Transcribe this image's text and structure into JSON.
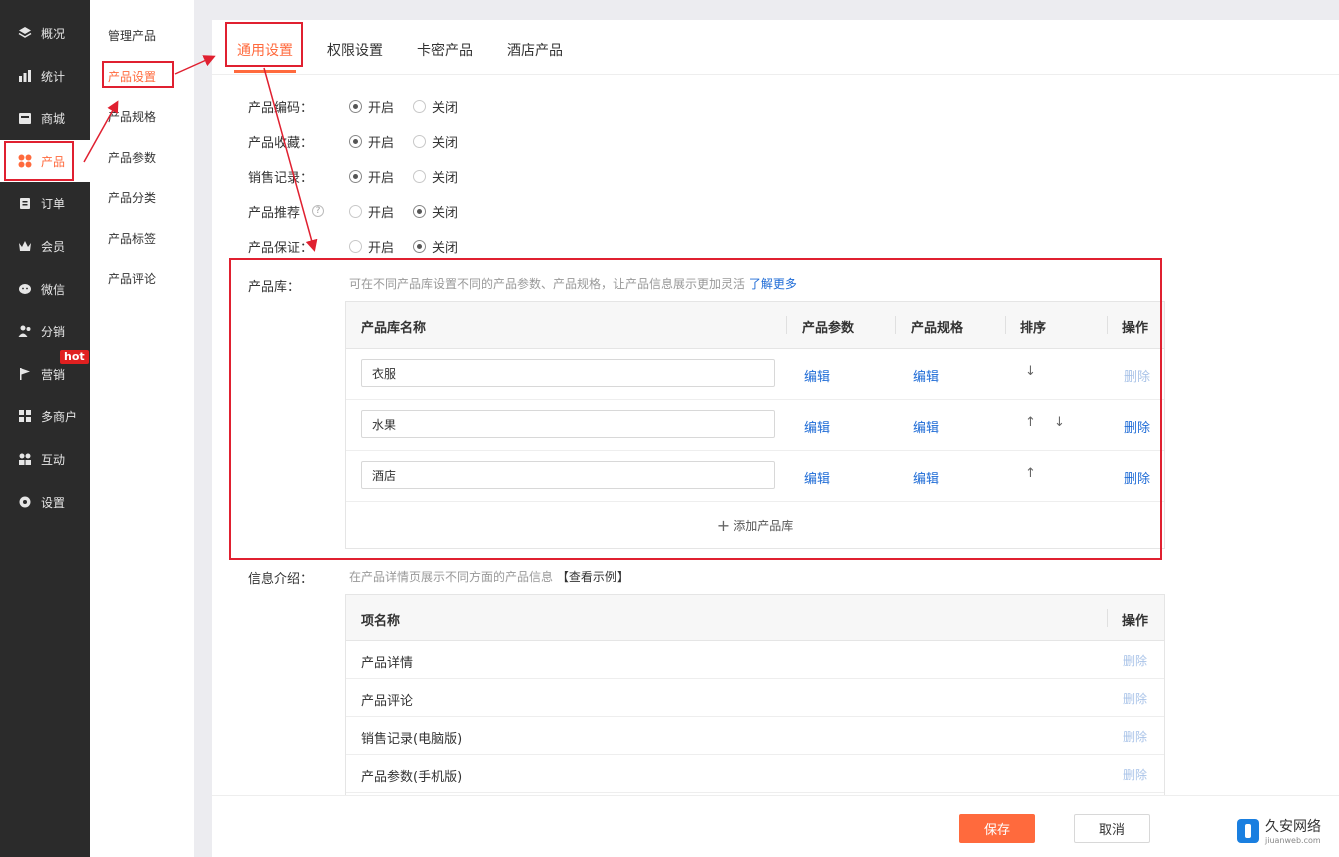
{
  "sidebar": {
    "items": [
      {
        "label": "概况",
        "icon": "layers-icon"
      },
      {
        "label": "统计",
        "icon": "chart-icon"
      },
      {
        "label": "商城",
        "icon": "shop-icon"
      },
      {
        "label": "产品",
        "icon": "grid-icon"
      },
      {
        "label": "订单",
        "icon": "clipboard-icon"
      },
      {
        "label": "会员",
        "icon": "crown-icon"
      },
      {
        "label": "微信",
        "icon": "wechat-icon"
      },
      {
        "label": "分销",
        "icon": "users-icon"
      },
      {
        "label": "营销",
        "icon": "flag-icon"
      },
      {
        "label": "多商户",
        "icon": "store-icon"
      },
      {
        "label": "互动",
        "icon": "people-icon"
      },
      {
        "label": "设置",
        "icon": "gear-icon"
      }
    ],
    "hot_badge": "hot"
  },
  "subnav": {
    "items": [
      "管理产品",
      "产品设置",
      "产品规格",
      "产品参数",
      "产品分类",
      "产品标签",
      "产品评论"
    ]
  },
  "tabs": [
    "通用设置",
    "权限设置",
    "卡密产品",
    "酒店产品"
  ],
  "settings": [
    {
      "label": "产品编码：",
      "on": "开启",
      "off": "关闭",
      "value": "on"
    },
    {
      "label": "产品收藏：",
      "on": "开启",
      "off": "关闭",
      "value": "on"
    },
    {
      "label": "销售记录：",
      "on": "开启",
      "off": "关闭",
      "value": "on"
    },
    {
      "label": "产品推荐",
      "on": "开启",
      "off": "关闭",
      "value": "off"
    },
    {
      "label": "产品保证：",
      "on": "开启",
      "off": "关闭",
      "value": "off"
    }
  ],
  "library": {
    "label": "产品库：",
    "hint": "可在不同产品库设置不同的产品参数、产品规格，让产品信息展示更加灵活",
    "hint_link": "了解更多",
    "columns": [
      "产品库名称",
      "产品参数",
      "产品规格",
      "排序",
      "操作"
    ],
    "rows": [
      {
        "name": "衣服",
        "param": "编辑",
        "spec": "编辑",
        "up": "",
        "down": "↓",
        "action": "删除",
        "action_enabled": false
      },
      {
        "name": "水果",
        "param": "编辑",
        "spec": "编辑",
        "up": "↑",
        "down": "↓",
        "action": "删除",
        "action_enabled": true
      },
      {
        "name": "酒店",
        "param": "编辑",
        "spec": "编辑",
        "up": "↑",
        "down": "",
        "action": "删除",
        "action_enabled": true
      }
    ],
    "add_label": "添加产品库"
  },
  "info": {
    "label": "信息介绍：",
    "hint": "在产品详情页展示不同方面的产品信息",
    "hint_link": "【查看示例】",
    "columns": [
      "项名称",
      "操作"
    ],
    "rows": [
      {
        "name": "产品详情",
        "action": "删除"
      },
      {
        "name": "产品评论",
        "action": "删除"
      },
      {
        "name": "销售记录(电脑版)",
        "action": "删除"
      },
      {
        "name": "产品参数(手机版)",
        "action": "删除"
      }
    ]
  },
  "footer": {
    "save": "保存",
    "cancel": "取消"
  },
  "watermark": {
    "line1": "久安网络",
    "line2": "jiuanweb.com"
  },
  "colors": {
    "accent": "#ff6a3d",
    "link": "#1e6bd6",
    "annotation": "#e02030",
    "sidebar_bg": "#2b2b2b"
  }
}
